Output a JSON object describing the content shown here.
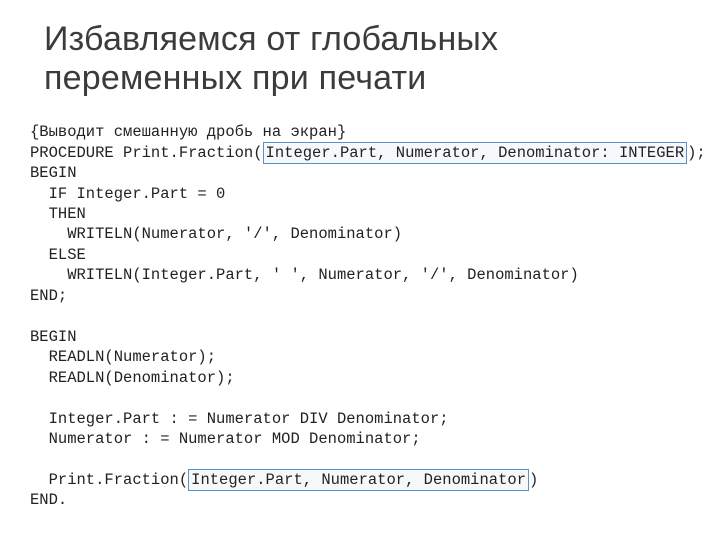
{
  "title": "Избавляемся от глобальных переменных при печати",
  "code": {
    "l1": "{Выводит смешанную дробь на экран}",
    "l2a": "PROCEDURE Print.Fraction(",
    "l2b": "Integer.Part, Numerator, Denominator: INTEGER",
    "l2c": ");",
    "l3": "BEGIN",
    "l4": "  IF Integer.Part = 0",
    "l5": "  THEN",
    "l6": "    WRITELN(Numerator, '/', Denominator)",
    "l7": "  ELSE",
    "l8": "    WRITELN(Integer.Part, ' ', Numerator, '/', Denominator)",
    "l9": "END;",
    "blank1": "",
    "l10": "BEGIN",
    "l11": "  READLN(Numerator);",
    "l12": "  READLN(Denominator);",
    "blank2": "",
    "l13": "  Integer.Part : = Numerator DIV Denominator;",
    "l14": "  Numerator : = Numerator MOD Denominator;",
    "blank3": "",
    "l15a": "  Print.Fraction(",
    "l15b": "Integer.Part, Numerator, Denominator",
    "l15c": ")",
    "l16": "END."
  }
}
